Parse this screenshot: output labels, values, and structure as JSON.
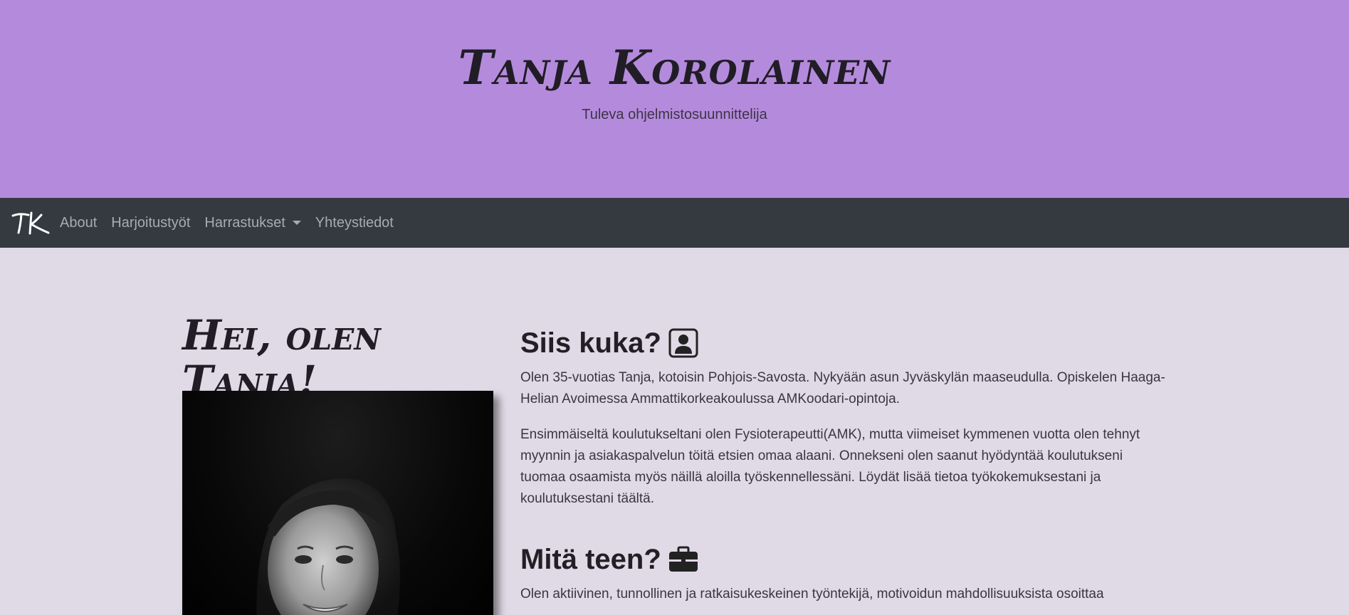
{
  "header": {
    "title": "Tanja Korolainen",
    "subtitle": "Tuleva ohjelmistosuunnittelija"
  },
  "navbar": {
    "brand": "TK",
    "links": [
      {
        "label": "About"
      },
      {
        "label": "Harjoitustyöt"
      },
      {
        "label": "Harrastukset"
      },
      {
        "label": "Yhteystiedot"
      }
    ]
  },
  "main": {
    "greeting": "Hei, olen Tanja!",
    "section1": {
      "title": "Siis kuka?",
      "icon": "person-badge-icon",
      "p1": "Olen 35-vuotias Tanja, kotoisin Pohjois-Savosta. Nykyään asun Jyväskylän maaseudulla. Opiskelen Haaga-Helian Avoimessa Ammattikorkeakoulussa AMKoodari-opintoja.",
      "p2": "Ensimmäiseltä koulutukseltani olen Fysioterapeutti(AMK), mutta viimeiset kymmenen vuotta olen tehnyt myynnin ja asiakaspalvelun töitä etsien omaa alaani. Onnekseni olen saanut hyödyntää koulutukseni tuomaa osaamista myös näillä aloilla työskennellessäni. Löydät lisää tietoa työkokemuksestani ja koulutuksestani täältä."
    },
    "section2": {
      "title": "Mitä teen?",
      "icon": "briefcase-icon",
      "p1": "Olen aktiivinen, tunnollinen ja ratkaisukeskeinen työntekijä, motivoidun mahdollisuuksista osoittaa"
    }
  },
  "colors": {
    "header_bg": "#b48bdc",
    "navbar_bg": "#343a40",
    "page_bg": "#e0d9e6"
  }
}
